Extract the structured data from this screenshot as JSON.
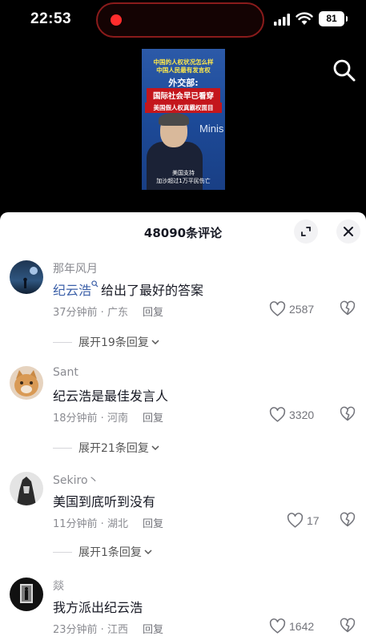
{
  "status_bar": {
    "time": "22:53",
    "battery": "81"
  },
  "video": {
    "title_lines": [
      "中国的人权状况怎么样",
      "中国人民最有发言权"
    ],
    "speaker_tag": "外交部:",
    "headline_1": "国际社会早已看穿",
    "headline_2": "美国假人权真霸权面目",
    "wall_text": "Minis",
    "caption_lines": [
      "美国支持",
      "加沙超过1万平民伤亡"
    ]
  },
  "comments_panel": {
    "title": "48090条评论",
    "comments": [
      {
        "username": "那年风月",
        "mention": "纪云浩",
        "text": "给出了最好的答案",
        "meta": "37分钟前 · 广东",
        "reply_label": "回复",
        "likes": "2587",
        "expand": "展开19条回复"
      },
      {
        "username": "Sant",
        "text": "纪云浩是最佳发言人",
        "meta": "18分钟前 · 河南",
        "reply_label": "回复",
        "likes": "3320",
        "expand": "展开21条回复"
      },
      {
        "username": "Sekiro丶",
        "text": "美国到底听到没有",
        "meta": "11分钟前 · 湖北",
        "reply_label": "回复",
        "likes": "17",
        "expand": "展开1条回复"
      },
      {
        "username": "燚",
        "text": "我方派出纪云浩",
        "meta": "23分钟前 · 江西",
        "reply_label": "回复",
        "likes": "1642"
      }
    ]
  },
  "colors": {
    "mention": "#3b5fa8",
    "recording": "#ff2d2d"
  },
  "icons": [
    "search-icon",
    "expand-icon",
    "close-icon",
    "heart-icon",
    "dislike-icon",
    "chevron-down-icon"
  ]
}
